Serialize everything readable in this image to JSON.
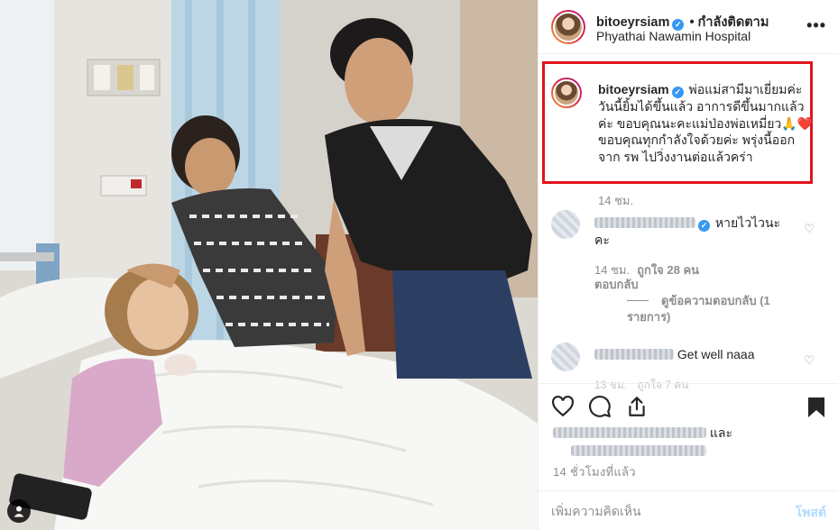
{
  "header": {
    "username": "bitoeyrsiam",
    "follow_status": "• กำลังติดตาม",
    "location": "Phyathai Nawamin Hospital",
    "verified_icon": "verified-badge-icon",
    "more_icon": "more-options-icon"
  },
  "caption": {
    "username": "bitoeyrsiam",
    "text": "พ่อแม่สามีมาเยี่ยมค่ะ วันนี้ยิ้มได้ขึ้นแล้ว อาการดีขึ้นมากแล้วค่ะ ขอบคุณนะคะแม่ป่องพ่อเหมี่ยว🙏❤️ ขอบคุณทุกกำลังใจด้วยค่ะ พรุ่งนี้ออกจาก รพ ไปวิ่งงานต่อแล้วคร่า",
    "time": "14 ชม.",
    "highlight_color": "#e0151c"
  },
  "comments": [
    {
      "text": "หายไวไวนะคะ",
      "time": "14 ชม.",
      "likes": "ถูกใจ 28 คน",
      "reply_label": "ตอบกลับ",
      "view_replies": "ดูข้อความตอบกลับ (1 รายการ)"
    },
    {
      "text": "Get well naaa",
      "time": "13 ชม.",
      "likes": "ถูกใจ 7 คน"
    }
  ],
  "actions": {
    "like_icon": "heart-icon",
    "comment_icon": "comment-icon",
    "share_icon": "share-icon",
    "save_icon": "bookmark-icon"
  },
  "likes_summary": "และ",
  "post_time": "14 ชั่วโมงที่แล้ว",
  "add_comment": {
    "placeholder": "เพิ่มความคิดเห็น",
    "post_label": "โพสต์"
  },
  "colors": {
    "verified": "#3897f0",
    "post_button_disabled": "#b3dbff",
    "secondary_text": "#8e8e8e"
  }
}
